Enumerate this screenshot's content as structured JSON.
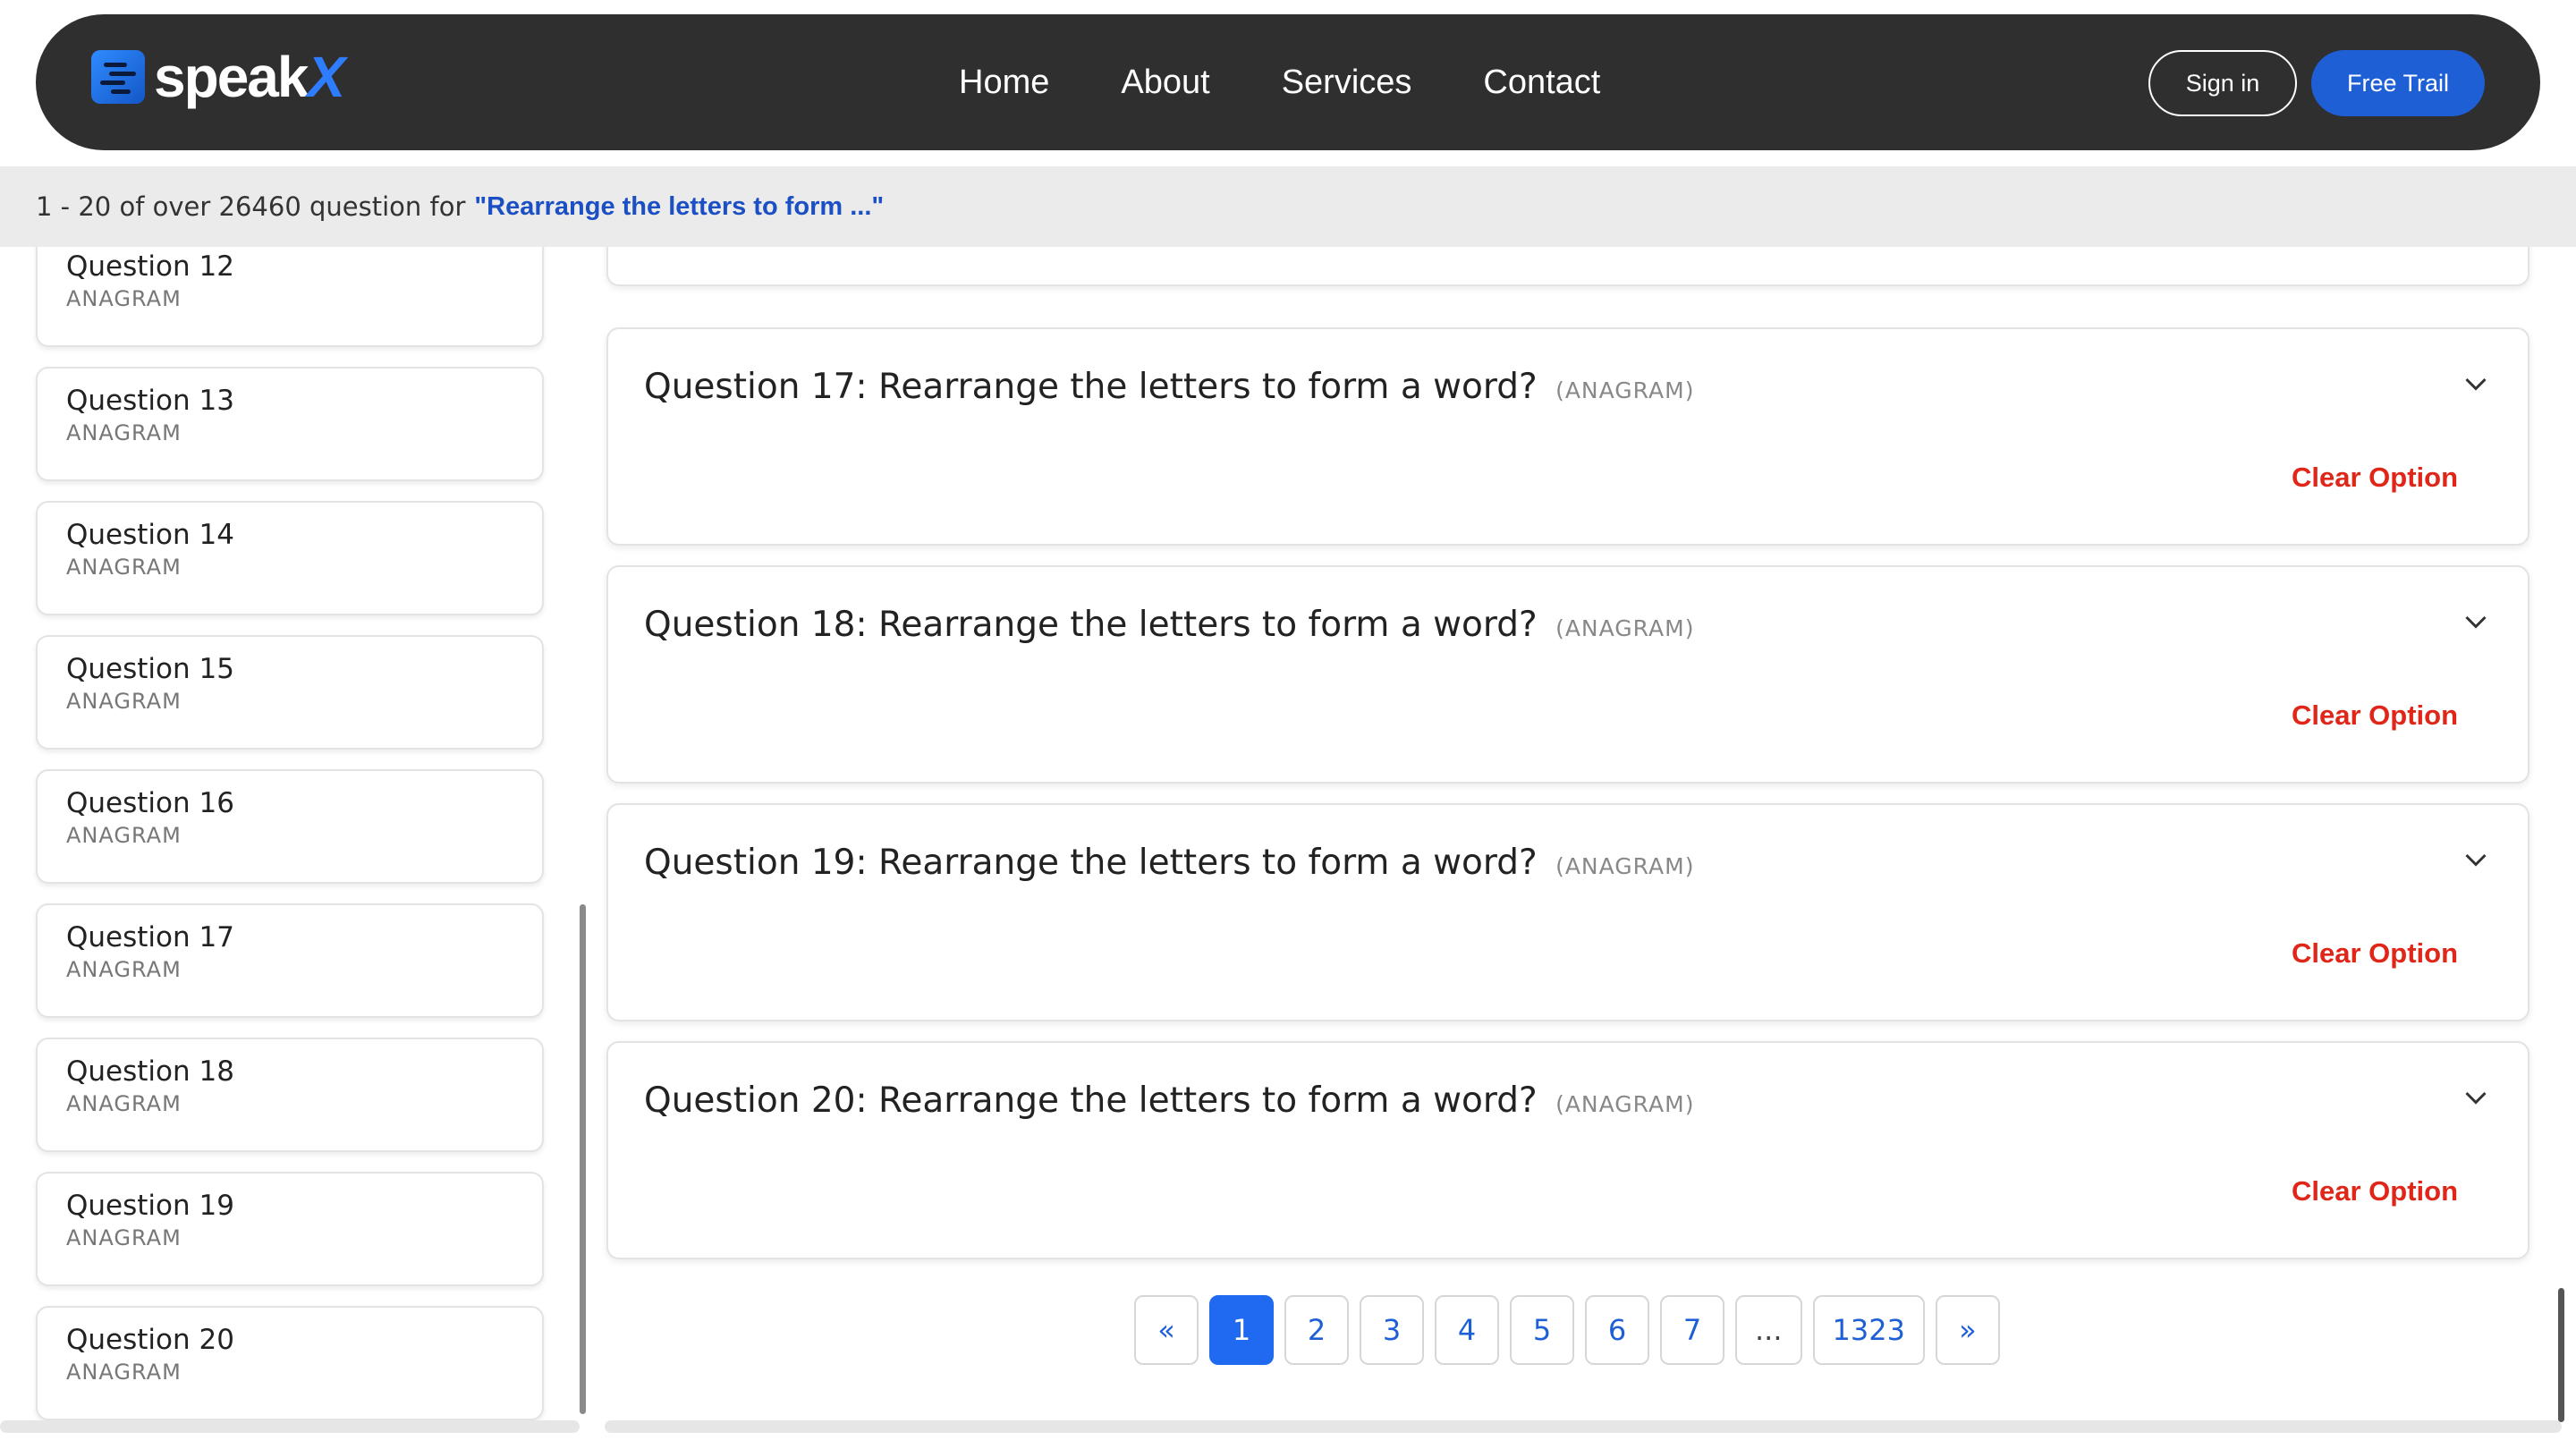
{
  "brand": {
    "name": "speak",
    "name_accent": "X"
  },
  "nav": {
    "links": [
      "Home",
      "About",
      "Services",
      "Contact"
    ],
    "sign_in": "Sign in",
    "free_trial": "Free Trail"
  },
  "results": {
    "summary": "1 - 20 of over 26460 question for",
    "query": "\"Rearrange the letters to form ...\""
  },
  "sidebar": {
    "items": [
      {
        "title": "Question 12",
        "tag": "ANAGRAM"
      },
      {
        "title": "Question 13",
        "tag": "ANAGRAM"
      },
      {
        "title": "Question 14",
        "tag": "ANAGRAM"
      },
      {
        "title": "Question 15",
        "tag": "ANAGRAM"
      },
      {
        "title": "Question 16",
        "tag": "ANAGRAM"
      },
      {
        "title": "Question 17",
        "tag": "ANAGRAM"
      },
      {
        "title": "Question 18",
        "tag": "ANAGRAM"
      },
      {
        "title": "Question 19",
        "tag": "ANAGRAM"
      },
      {
        "title": "Question 20",
        "tag": "ANAGRAM"
      }
    ]
  },
  "questions": [
    {
      "title": "Question 17: Rearrange the letters to form a word?",
      "tag": "(ANAGRAM)",
      "clear": "Clear Option"
    },
    {
      "title": "Question 18: Rearrange the letters to form a word?",
      "tag": "(ANAGRAM)",
      "clear": "Clear Option"
    },
    {
      "title": "Question 19: Rearrange the letters to form a word?",
      "tag": "(ANAGRAM)",
      "clear": "Clear Option"
    },
    {
      "title": "Question 20: Rearrange the letters to form a word?",
      "tag": "(ANAGRAM)",
      "clear": "Clear Option"
    }
  ],
  "pagination": {
    "prev": "«",
    "pages": [
      "1",
      "2",
      "3",
      "4",
      "5",
      "6",
      "7"
    ],
    "ellipsis": "...",
    "last": "1323",
    "next": "»",
    "current": "1"
  },
  "colors": {
    "nav_bg": "#2f2f2f",
    "accent": "#1f5fd6",
    "clear_red": "#e02618",
    "query_blue": "#1b4fc4"
  }
}
